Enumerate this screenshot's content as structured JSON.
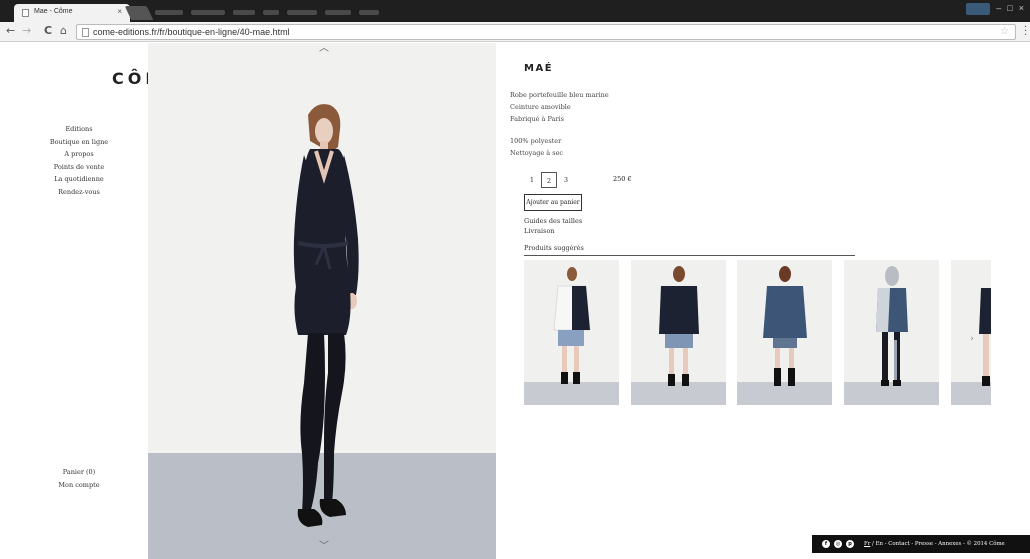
{
  "browser": {
    "tab_title": "Mae - Côme",
    "tab_close": "×",
    "url": "come-editions.fr/fr/boutique-en-ligne/40-mae.html",
    "back": "←",
    "forward": "→",
    "reload": "C",
    "home": "⌂",
    "star": "☆",
    "win_minimize": "–",
    "win_maximize": "□",
    "win_close": "×"
  },
  "site": {
    "logo": "CÔME",
    "nav": [
      "Editions",
      "Boutique en ligne",
      "A propos",
      "Points de vente",
      "La quotidienne",
      "Rendez-vous"
    ],
    "basket": "Panier (0)",
    "account": "Mon compte"
  },
  "product": {
    "title": "MAÉ",
    "description": [
      "Robe portefeuille bleu marine",
      "Ceinture amovible",
      "Fabriqué à Paris"
    ],
    "care": [
      "100% polyester",
      "Nettoyage à sec"
    ],
    "sizes": [
      "1",
      "2",
      "3"
    ],
    "selected_size": "2",
    "price": "250 €",
    "add_to_cart": "Ajouter au panier",
    "links": [
      "Guides des tailles",
      "Livraison"
    ],
    "suggested_title": "Produits suggérés"
  },
  "arrows": {
    "up": "︿",
    "down": "﹀",
    "next": "›"
  },
  "footer": {
    "social": [
      {
        "icon": "facebook-icon",
        "glyph": "f"
      },
      {
        "icon": "instagram-icon",
        "glyph": "◎"
      },
      {
        "icon": "pinterest-icon",
        "glyph": "p"
      }
    ],
    "lang_fr": "Fr",
    "lang_sep": " / ",
    "lang_en": "En",
    "rest": " - Contact - Presse - Annexes - © 2014 Côme"
  },
  "colors": {
    "dress": "#1c1f2b",
    "floor": "#b9bec7",
    "footer_bg": "#111111"
  }
}
